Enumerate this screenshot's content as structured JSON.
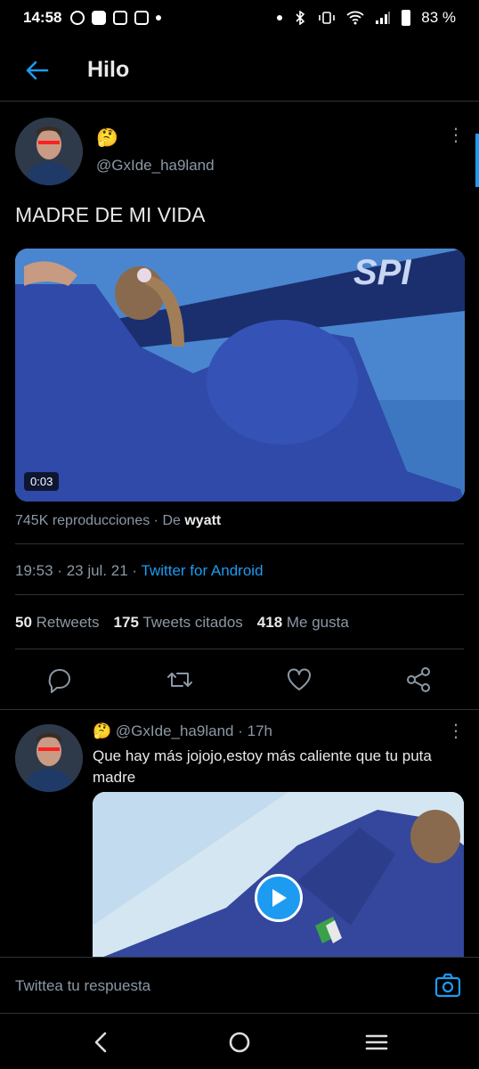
{
  "status_bar": {
    "time": "14:58",
    "battery": "83 %",
    "left_icons": [
      "whatsapp-icon",
      "square-icon",
      "instagram-icon",
      "app-icon"
    ],
    "right_icons": [
      "bluetooth-icon",
      "vibrate-icon",
      "wifi-icon",
      "signal-icon",
      "battery-icon"
    ]
  },
  "header": {
    "title": "Hilo",
    "back_icon": "arrow-left-icon"
  },
  "main_tweet": {
    "name_emoji": "🤔",
    "handle": "@GxIde_ha9land",
    "text": "MADRE DE MI VIDA",
    "media": {
      "duration": "0:03"
    },
    "views": "745K reproducciones",
    "separator": "·",
    "from_label": "De",
    "from_user": "wyatt",
    "time": "19:53",
    "date": "23 jul. 21",
    "source": "Twitter for Android",
    "stats": {
      "retweets_count": "50",
      "retweets_label": "Retweets",
      "quotes_count": "175",
      "quotes_label": "Tweets citados",
      "likes_count": "418",
      "likes_label": "Me gusta"
    }
  },
  "actions": [
    "reply-icon",
    "retweet-icon",
    "like-icon",
    "share-icon"
  ],
  "reply_tweet": {
    "name_emoji": "🤔",
    "handle": "@GxIde_ha9land",
    "age": "17h",
    "text": "Que hay más jojojo,estoy más caliente que tu puta madre"
  },
  "reply_bar": {
    "placeholder": "Twittea tu respuesta"
  },
  "navbar": [
    "nav-back-icon",
    "nav-home-icon",
    "nav-recents-icon"
  ],
  "colors": {
    "background": "#000000",
    "text": "#e7e9ea",
    "muted": "#8b98a5",
    "accent": "#1d9bf0",
    "divider": "#2f3336"
  }
}
